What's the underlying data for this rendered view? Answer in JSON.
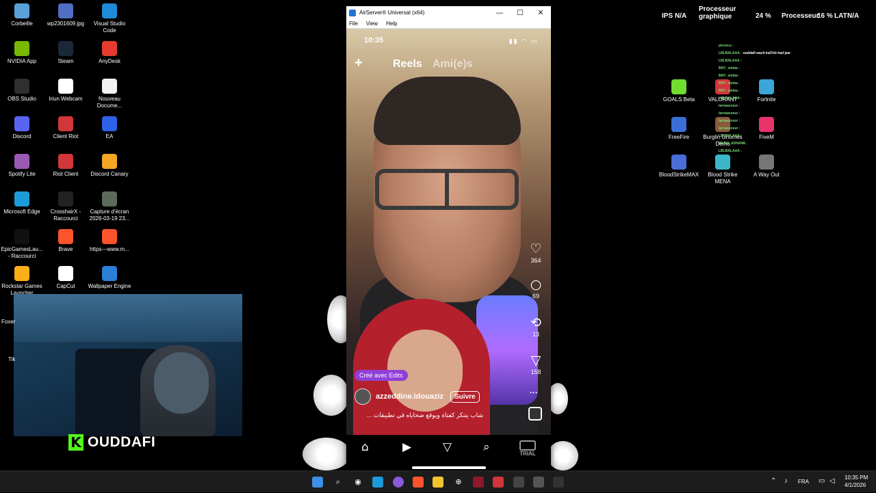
{
  "desktop": {
    "icons": [
      {
        "label": "Corbeille",
        "icon": "recycle-bin-icon",
        "color": "#5aa0d8"
      },
      {
        "label": "wp2301609.jpg",
        "icon": "image-file-icon",
        "color": "#4f6ec1"
      },
      {
        "label": "Visual Studio Code",
        "icon": "vscode-icon",
        "color": "#1f8ad6"
      },
      {
        "label": "NVIDIA App",
        "icon": "nvidia-icon",
        "color": "#76b900"
      },
      {
        "label": "Steam",
        "icon": "steam-icon",
        "color": "#1b2838"
      },
      {
        "label": "AnyDesk",
        "icon": "anydesk-icon",
        "color": "#e63b2e"
      },
      {
        "label": "OBS Studio",
        "icon": "obs-icon",
        "color": "#302e31"
      },
      {
        "label": "Iriun Webcam",
        "icon": "webcam-icon",
        "color": "#ffffff"
      },
      {
        "label": "Nouveau Docume...",
        "icon": "document-icon",
        "color": "#f2f2f2"
      },
      {
        "label": "Discord",
        "icon": "discord-icon",
        "color": "#5865f2"
      },
      {
        "label": "Client Riot",
        "icon": "riot-icon",
        "color": "#d13639"
      },
      {
        "label": "EA",
        "icon": "ea-icon",
        "color": "#2e62e6"
      },
      {
        "label": "Spotify Lite",
        "icon": "spotify-icon",
        "color": "#9b59b6"
      },
      {
        "label": "Riot Client",
        "icon": "riot-icon",
        "color": "#d13639"
      },
      {
        "label": "Discord Canary",
        "icon": "discord-canary-icon",
        "color": "#f5a623"
      },
      {
        "label": "Microsoft Edge",
        "icon": "edge-icon",
        "color": "#1d9bd8"
      },
      {
        "label": "CrosshairX - Raccourci",
        "icon": "crosshair-icon",
        "color": "#222222"
      },
      {
        "label": "Capture d'écran 2026-03-19 23...",
        "icon": "screenshot-file-icon",
        "color": "#5b6b5a"
      },
      {
        "label": "EpicGamesLau... - Raccourci",
        "icon": "epic-games-icon",
        "color": "#111111"
      },
      {
        "label": "Brave",
        "icon": "brave-icon",
        "color": "#fb542b"
      },
      {
        "label": "https---www.m...",
        "icon": "brave-icon",
        "color": "#fb542b"
      },
      {
        "label": "Rockstar Games Launcher",
        "icon": "rockstar-icon",
        "color": "#fcaf17"
      },
      {
        "label": "CapCut",
        "icon": "capcut-icon",
        "color": "#ffffff"
      },
      {
        "label": "Wallpaper Engine",
        "icon": "wallpaper-engine-icon",
        "color": "#2b7fd6"
      },
      {
        "label": "GOALS Beta",
        "icon": "goals-icon",
        "color": "#6fdc2f"
      },
      {
        "label": "VALORANT",
        "icon": "valorant-icon",
        "color": "#d13639"
      },
      {
        "label": "Fortnite",
        "icon": "fortnite-icon",
        "color": "#3aa6d9"
      },
      {
        "label": "FreeFire",
        "icon": "freefire-icon",
        "color": "#3a6fd8"
      },
      {
        "label": "Burglin Gnomes Demo",
        "icon": "game-icon",
        "color": "#8a5a3a"
      },
      {
        "label": "FiveM",
        "icon": "fivem-icon",
        "color": "#e8346a"
      },
      {
        "label": "BloodStrikeMAX",
        "icon": "bloodstrike-icon",
        "color": "#4a6ed8"
      },
      {
        "label": "Blood Strike MENA",
        "icon": "bloodstrike-icon",
        "color": "#3db6c9"
      },
      {
        "label": "A Way Out",
        "icon": "game-icon",
        "color": "#777777"
      }
    ]
  },
  "overlay": {
    "ips_label": "IPS",
    "ips_value": "N/A",
    "gpu_label_1": "Processeur",
    "gpu_label_2": "graphique",
    "gpu_value": "24 %",
    "cpu_label": "Processeur",
    "cpu_value": "16 %",
    "lat_label": "LAT",
    "lat_value": "N/A"
  },
  "chat": [
    {
      "nick": "picvoca :",
      "text": ""
    },
    {
      "nick": "LBLBALAAA :",
      "text": "ouddafi wach kat7eb had jaw"
    },
    {
      "nick": "LBLBALAAA :",
      "text": ""
    },
    {
      "nick": "BNY_simba :",
      "text": ""
    },
    {
      "nick": "BNY_simba :",
      "text": ""
    },
    {
      "nick": "BNY_simba :",
      "text": ""
    },
    {
      "nick": "BNY_simba :",
      "text": ""
    },
    {
      "nick": "LBLBALAAA :",
      "text": ""
    },
    {
      "nick": "larnaacoeur :",
      "text": ""
    },
    {
      "nick": "larnaacoeur :",
      "text": ""
    },
    {
      "nick": "larnaacoeur :",
      "text": ""
    },
    {
      "nick": "larnaacoeur :",
      "text": ""
    },
    {
      "nick": "LBLBALAAA :",
      "text": ""
    },
    {
      "nick": "WLBG_ADNANE :",
      "text": ""
    },
    {
      "nick": "LBLBALAAA :",
      "text": ""
    }
  ],
  "stream": {
    "brand": "OUDDAFI",
    "brand_letter": "K",
    "side_label_1": "Foxer",
    "side_label_2": "Tik"
  },
  "window": {
    "title": "AirServer® Universal (x64)",
    "menu": [
      "File",
      "View",
      "Help"
    ],
    "min": "—",
    "max": "☐",
    "close": "✕"
  },
  "phone": {
    "time": "10:35",
    "status_icons": "▮▮ ◠ ▭",
    "plus": "+",
    "tab_reels": "Reels",
    "tab_friends": "Ami(e)s",
    "actions": [
      {
        "name": "like",
        "glyph": "♡",
        "count": "364"
      },
      {
        "name": "comment",
        "glyph": "○",
        "count": "69"
      },
      {
        "name": "repost",
        "glyph": "⟲",
        "count": "13"
      },
      {
        "name": "share",
        "glyph": "▽",
        "count": "158"
      }
    ],
    "edits_badge": "Créé avec Edits",
    "username": "azzeddine.idouaziz",
    "follow": "Suivre",
    "caption": "شاب يتنكر كفتاة ويوقع ضحاياه في تطبيقات ...",
    "more": "···",
    "trial": "TRIAL"
  },
  "taskbar": {
    "language": "FRA",
    "time": "10:35 PM",
    "date": "4/1/2026"
  }
}
